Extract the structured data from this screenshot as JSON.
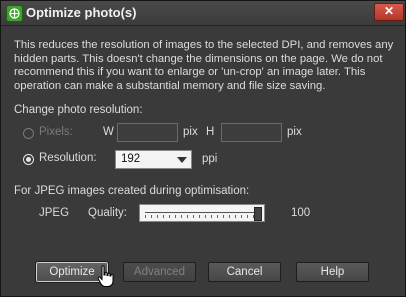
{
  "window": {
    "title": "Optimize photo(s)",
    "close_glyph": "✕",
    "app_icon": "globe-icon"
  },
  "description": "This reduces the resolution of images to the selected DPI, and removes any hidden parts. This doesn't change the dimensions on the page. We do not recommend this if you want to enlarge or 'un-crop' an image later. This operation can make a substantial memory and file size saving.",
  "resolution_section": {
    "heading": "Change photo resolution:",
    "pixels": {
      "label": "Pixels:",
      "selected": false,
      "enabled": false
    },
    "width_label": "W",
    "width_value": "",
    "width_unit": "pix",
    "height_label": "H",
    "height_value": "",
    "height_unit": "pix",
    "resolution": {
      "label": "Resolution:",
      "selected": true,
      "enabled": true
    },
    "resolution_value": "192",
    "resolution_unit": "ppi"
  },
  "jpeg_section": {
    "heading": "For JPEG images created during optimisation:",
    "jpeg_label": "JPEG",
    "quality_label": "Quality:",
    "quality_value": "100",
    "quality_fraction": 1.0
  },
  "buttons": {
    "optimize": "Optimize",
    "advanced": "Advanced",
    "cancel": "Cancel",
    "help": "Help"
  },
  "colors": {
    "window_bg": "#3a3a3a",
    "close_red": "#c8443a",
    "app_icon_green": "#3fa12e"
  },
  "cursor": "hand-pointer-icon"
}
